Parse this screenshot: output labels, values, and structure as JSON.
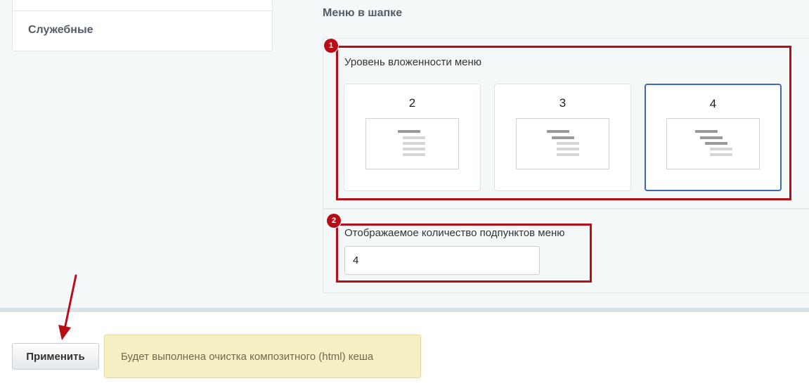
{
  "sidebar": {
    "items": [
      {
        "label": "Служебные"
      }
    ]
  },
  "section": {
    "title": "Меню в шапке"
  },
  "nesting": {
    "label": "Уровень вложенности меню",
    "options": [
      {
        "label": "2",
        "selected": false
      },
      {
        "label": "3",
        "selected": false
      },
      {
        "label": "4",
        "selected": true
      }
    ]
  },
  "subitems": {
    "label": "Отображаемое количество подпунктов меню",
    "value": "4"
  },
  "markers": [
    {
      "label": "1"
    },
    {
      "label": "2"
    }
  ],
  "footer": {
    "apply_label": "Применить",
    "notice": "Будет выполнена очистка композитного (html) кеша"
  },
  "colors": {
    "highlight": "#b50e16",
    "selected_border": "#3d68b6",
    "notice_bg": "#f7efc4"
  }
}
